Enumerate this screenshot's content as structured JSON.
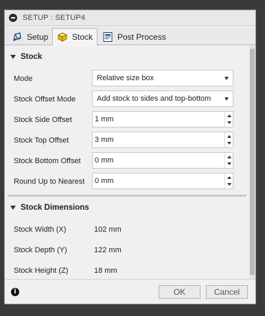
{
  "window": {
    "title": "SETUP : SETUP4"
  },
  "tabs": [
    {
      "label": "Setup",
      "icon": "setup-icon",
      "active": false
    },
    {
      "label": "Stock",
      "icon": "stock-icon",
      "active": true
    },
    {
      "label": "Post Process",
      "icon": "post-process-icon",
      "active": false
    }
  ],
  "stock_section": {
    "header": "Stock",
    "mode": {
      "label": "Mode",
      "value": "Relative size box"
    },
    "offset_mode": {
      "label": "Stock Offset Mode",
      "value": "Add stock to sides and top-bottom"
    },
    "side_offset": {
      "label": "Stock Side Offset",
      "value": "1 mm"
    },
    "top_offset": {
      "label": "Stock Top Offset",
      "value": "3 mm"
    },
    "bottom_offset": {
      "label": "Stock Bottom Offset",
      "value": "0 mm"
    },
    "round_up": {
      "label": "Round Up to Nearest",
      "value": "0 mm"
    }
  },
  "dimensions_section": {
    "header": "Stock Dimensions",
    "width": {
      "label": "Stock Width (X)",
      "value": "102 mm"
    },
    "depth": {
      "label": "Stock Depth (Y)",
      "value": "122 mm"
    },
    "height": {
      "label": "Stock Height (Z)",
      "value": "18 mm"
    }
  },
  "footer": {
    "ok_label": "OK",
    "cancel_label": "Cancel"
  },
  "colors": {
    "background": "#3a3a3a",
    "panel": "#f0f0f0",
    "stock_icon": "#f2c200"
  }
}
